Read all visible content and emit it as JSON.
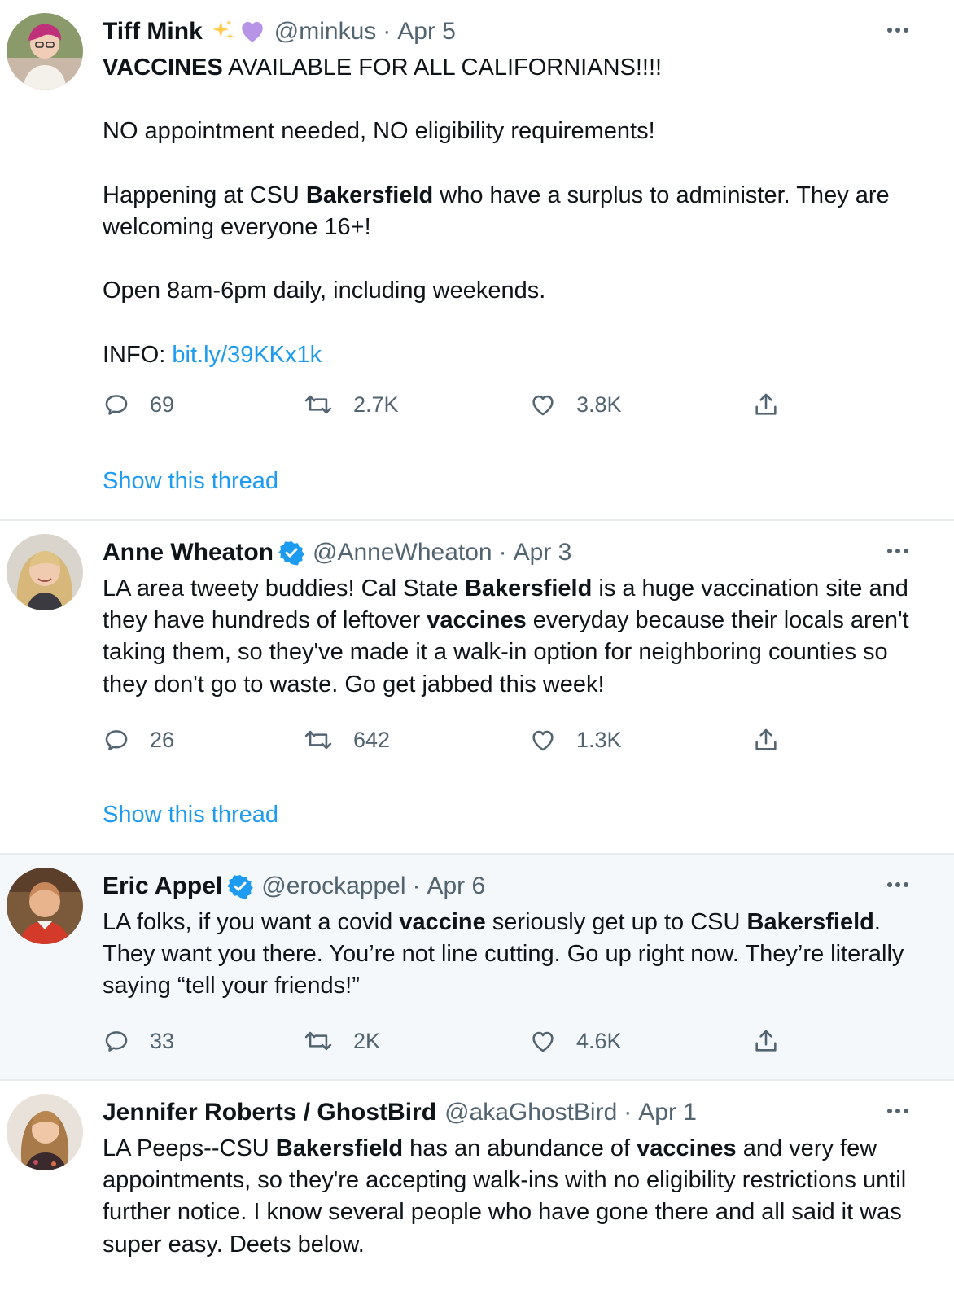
{
  "tweets": [
    {
      "name": "Tiff Mink",
      "handle": "@minkus",
      "separator": "·",
      "date": "Apr 5",
      "emoji": [
        "sparkles",
        "purple-heart"
      ],
      "verified": false,
      "highlighted": false,
      "paragraphs": [
        [
          {
            "t": "VACCINES",
            "b": true
          },
          {
            "t": " AVAILABLE FOR ALL CALIFORNIANS!!!!"
          }
        ],
        [
          {
            "t": "NO appointment needed, NO eligibility requirements!"
          }
        ],
        [
          {
            "t": "Happening at CSU "
          },
          {
            "t": "Bakersfield",
            "b": true
          },
          {
            "t": " who have a surplus to administer. They are welcoming everyone 16+!"
          }
        ],
        [
          {
            "t": "Open 8am-6pm daily, including weekends."
          }
        ],
        [
          {
            "t": "INFO: "
          },
          {
            "t": "bit.ly/39KKx1k",
            "link": true
          }
        ]
      ],
      "replies": "69",
      "retweets": "2.7K",
      "likes": "3.8K",
      "show_thread": "Show this thread"
    },
    {
      "name": "Anne Wheaton",
      "handle": "@AnneWheaton",
      "separator": "·",
      "date": "Apr 3",
      "verified": true,
      "highlighted": false,
      "paragraphs": [
        [
          {
            "t": "LA area tweety buddies! Cal State "
          },
          {
            "t": "Bakersfield",
            "b": true
          },
          {
            "t": " is a huge vaccination site and they have hundreds of leftover "
          },
          {
            "t": "vaccines",
            "b": true
          },
          {
            "t": " everyday because their locals aren't taking them, so they've made it a walk-in option for neighboring counties so they don't go to waste. Go get jabbed this week!"
          }
        ]
      ],
      "replies": "26",
      "retweets": "642",
      "likes": "1.3K",
      "show_thread": "Show this thread"
    },
    {
      "name": "Eric Appel",
      "handle": "@erockappel",
      "separator": "·",
      "date": "Apr 6",
      "verified": true,
      "highlighted": true,
      "paragraphs": [
        [
          {
            "t": "LA folks, if you want a covid "
          },
          {
            "t": "vaccine",
            "b": true
          },
          {
            "t": " seriously get up to CSU "
          },
          {
            "t": "Bakersfield",
            "b": true
          },
          {
            "t": ". They want you there. You’re not line cutting. Go up right now. They’re literally saying “tell your friends!”"
          }
        ]
      ],
      "replies": "33",
      "retweets": "2K",
      "likes": "4.6K"
    },
    {
      "name": "Jennifer Roberts / GhostBird",
      "handle": "@akaGhostBird",
      "separator": "·",
      "date": "Apr 1",
      "verified": false,
      "highlighted": false,
      "paragraphs": [
        [
          {
            "t": "LA Peeps--CSU "
          },
          {
            "t": "Bakersfield",
            "b": true
          },
          {
            "t": " has an abundance of "
          },
          {
            "t": "vaccines",
            "b": true
          },
          {
            "t": " and very few appointments, so they're accepting walk-ins with no eligibility restrictions until further notice. I know several people who have gone there and all said it was super easy. Deets below."
          }
        ]
      ]
    }
  ],
  "colors": {
    "text": "#0f1419",
    "secondary": "#536471",
    "link": "#1d9bf0",
    "verified": "#1d9bf0",
    "divider": "#e6ecf0",
    "highlight_bg": "#f5f8fa",
    "purple_heart": "#b794e6",
    "sparkles": "#ffcc4d"
  }
}
